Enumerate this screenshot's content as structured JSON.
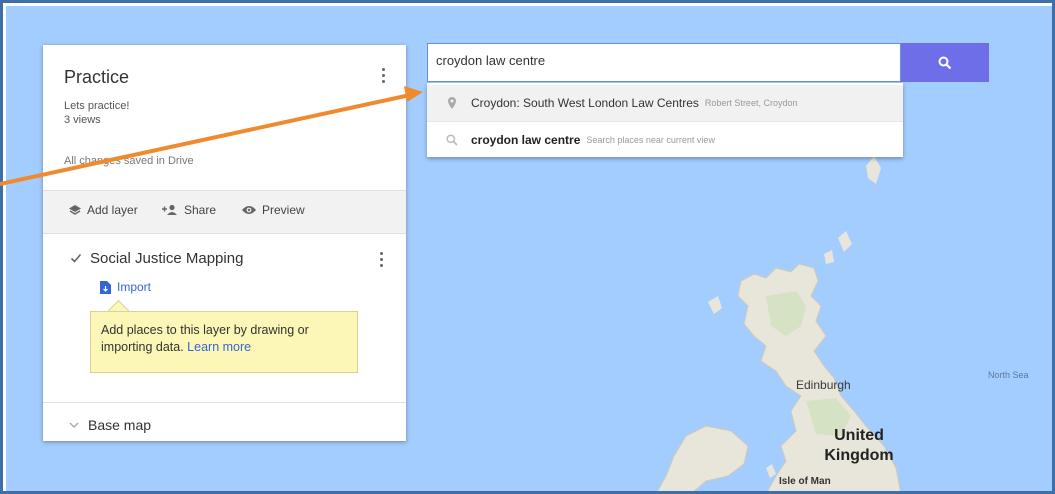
{
  "map_panel": {
    "title": "Practice",
    "description": "Lets practice!",
    "views": "3 views",
    "save_status": "All changes saved in Drive",
    "toolbar": {
      "add_layer": "Add layer",
      "share": "Share",
      "preview": "Preview"
    },
    "layer": {
      "name": "Social Justice Mapping",
      "checked": true,
      "import_label": "Import",
      "hint_text": "Add places to this layer by drawing or importing data.",
      "learn_more": "Learn more"
    },
    "base_map": "Base map"
  },
  "search": {
    "query": "croydon law centre",
    "suggestions": [
      {
        "icon": "place-pin-icon",
        "main": "Croydon: South West London Law Centres",
        "sub": "Robert Street, Croydon"
      },
      {
        "icon": "search-icon",
        "main": "croydon law centre",
        "sub": "Search places near current view"
      }
    ]
  },
  "map_labels": {
    "edinburgh": "Edinburgh",
    "united": "United",
    "kingdom": "Kingdom",
    "isle_of_man": "Isle of Man",
    "north_sea": "North Sea"
  },
  "colors": {
    "water": "#a3ccff",
    "land": "#e8e6da",
    "accent": "#6d6ee8",
    "arrow": "#f08a2e",
    "hint_bg": "#fcf7b6"
  }
}
